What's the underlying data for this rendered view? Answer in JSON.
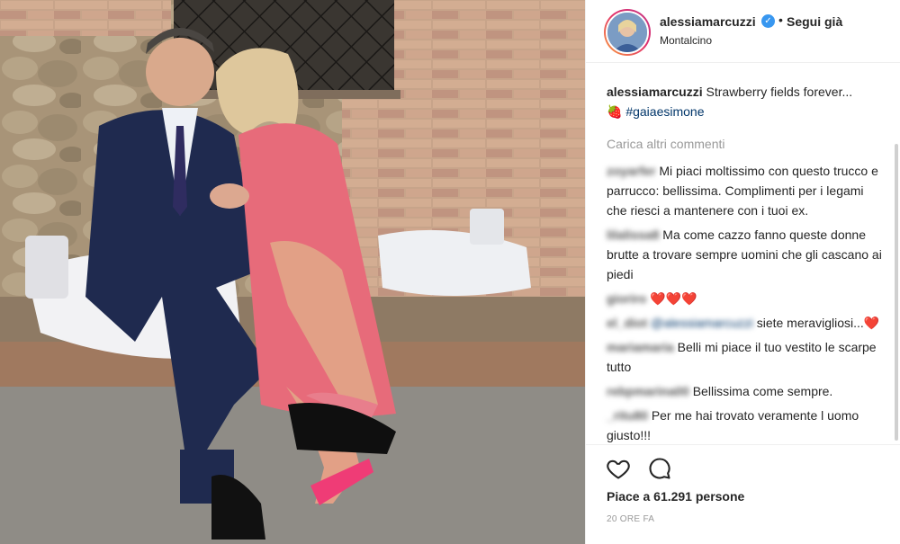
{
  "header": {
    "username": "alessiamarcuzzi",
    "verified_mark": "✓",
    "separator": "•",
    "follow_label": "Segui già",
    "location": "Montalcino"
  },
  "caption": {
    "username": "alessiamarcuzzi",
    "text": "Strawberry fields forever...",
    "emoji": "🍓",
    "hashtag": "#gaiaesimone"
  },
  "load_more": "Carica altri commenti",
  "comments": [
    {
      "user": "zoyarfer",
      "text": "Mi piaci moltissimo con questo trucco e parrucco: bellissima. Complimenti per i legami che riesci a mantenere con i tuoi ex."
    },
    {
      "user": "lilalissa8",
      "text": "Ma come cazzo fanno queste donne brutte a trovare sempre uomini che gli cascano ai piedi"
    },
    {
      "user": "gioriro",
      "text": "❤️❤️❤️"
    },
    {
      "user": "el_diot",
      "mention": "@alessiamarcuzzi",
      "text": "siete meravigliosi...❤️"
    },
    {
      "user": "mariamaria",
      "text": "Belli mi piace il tuo vestito le scarpe tutto"
    },
    {
      "user": "rebpmarina00",
      "text": "Bellissima come sempre."
    },
    {
      "user": "_ritu80",
      "text": "Per me hai trovato veramente l uomo giusto!!!"
    }
  ],
  "actions": {
    "like_icon": "heart-outline-icon",
    "comment_icon": "comment-bubble-icon",
    "likes_text": "Piace a 61.291 persone",
    "timestamp": "20 ORE FA"
  },
  "colors": {
    "link": "#003569",
    "verified": "#3897f0",
    "muted": "#999999",
    "heart": "#e0245e"
  }
}
